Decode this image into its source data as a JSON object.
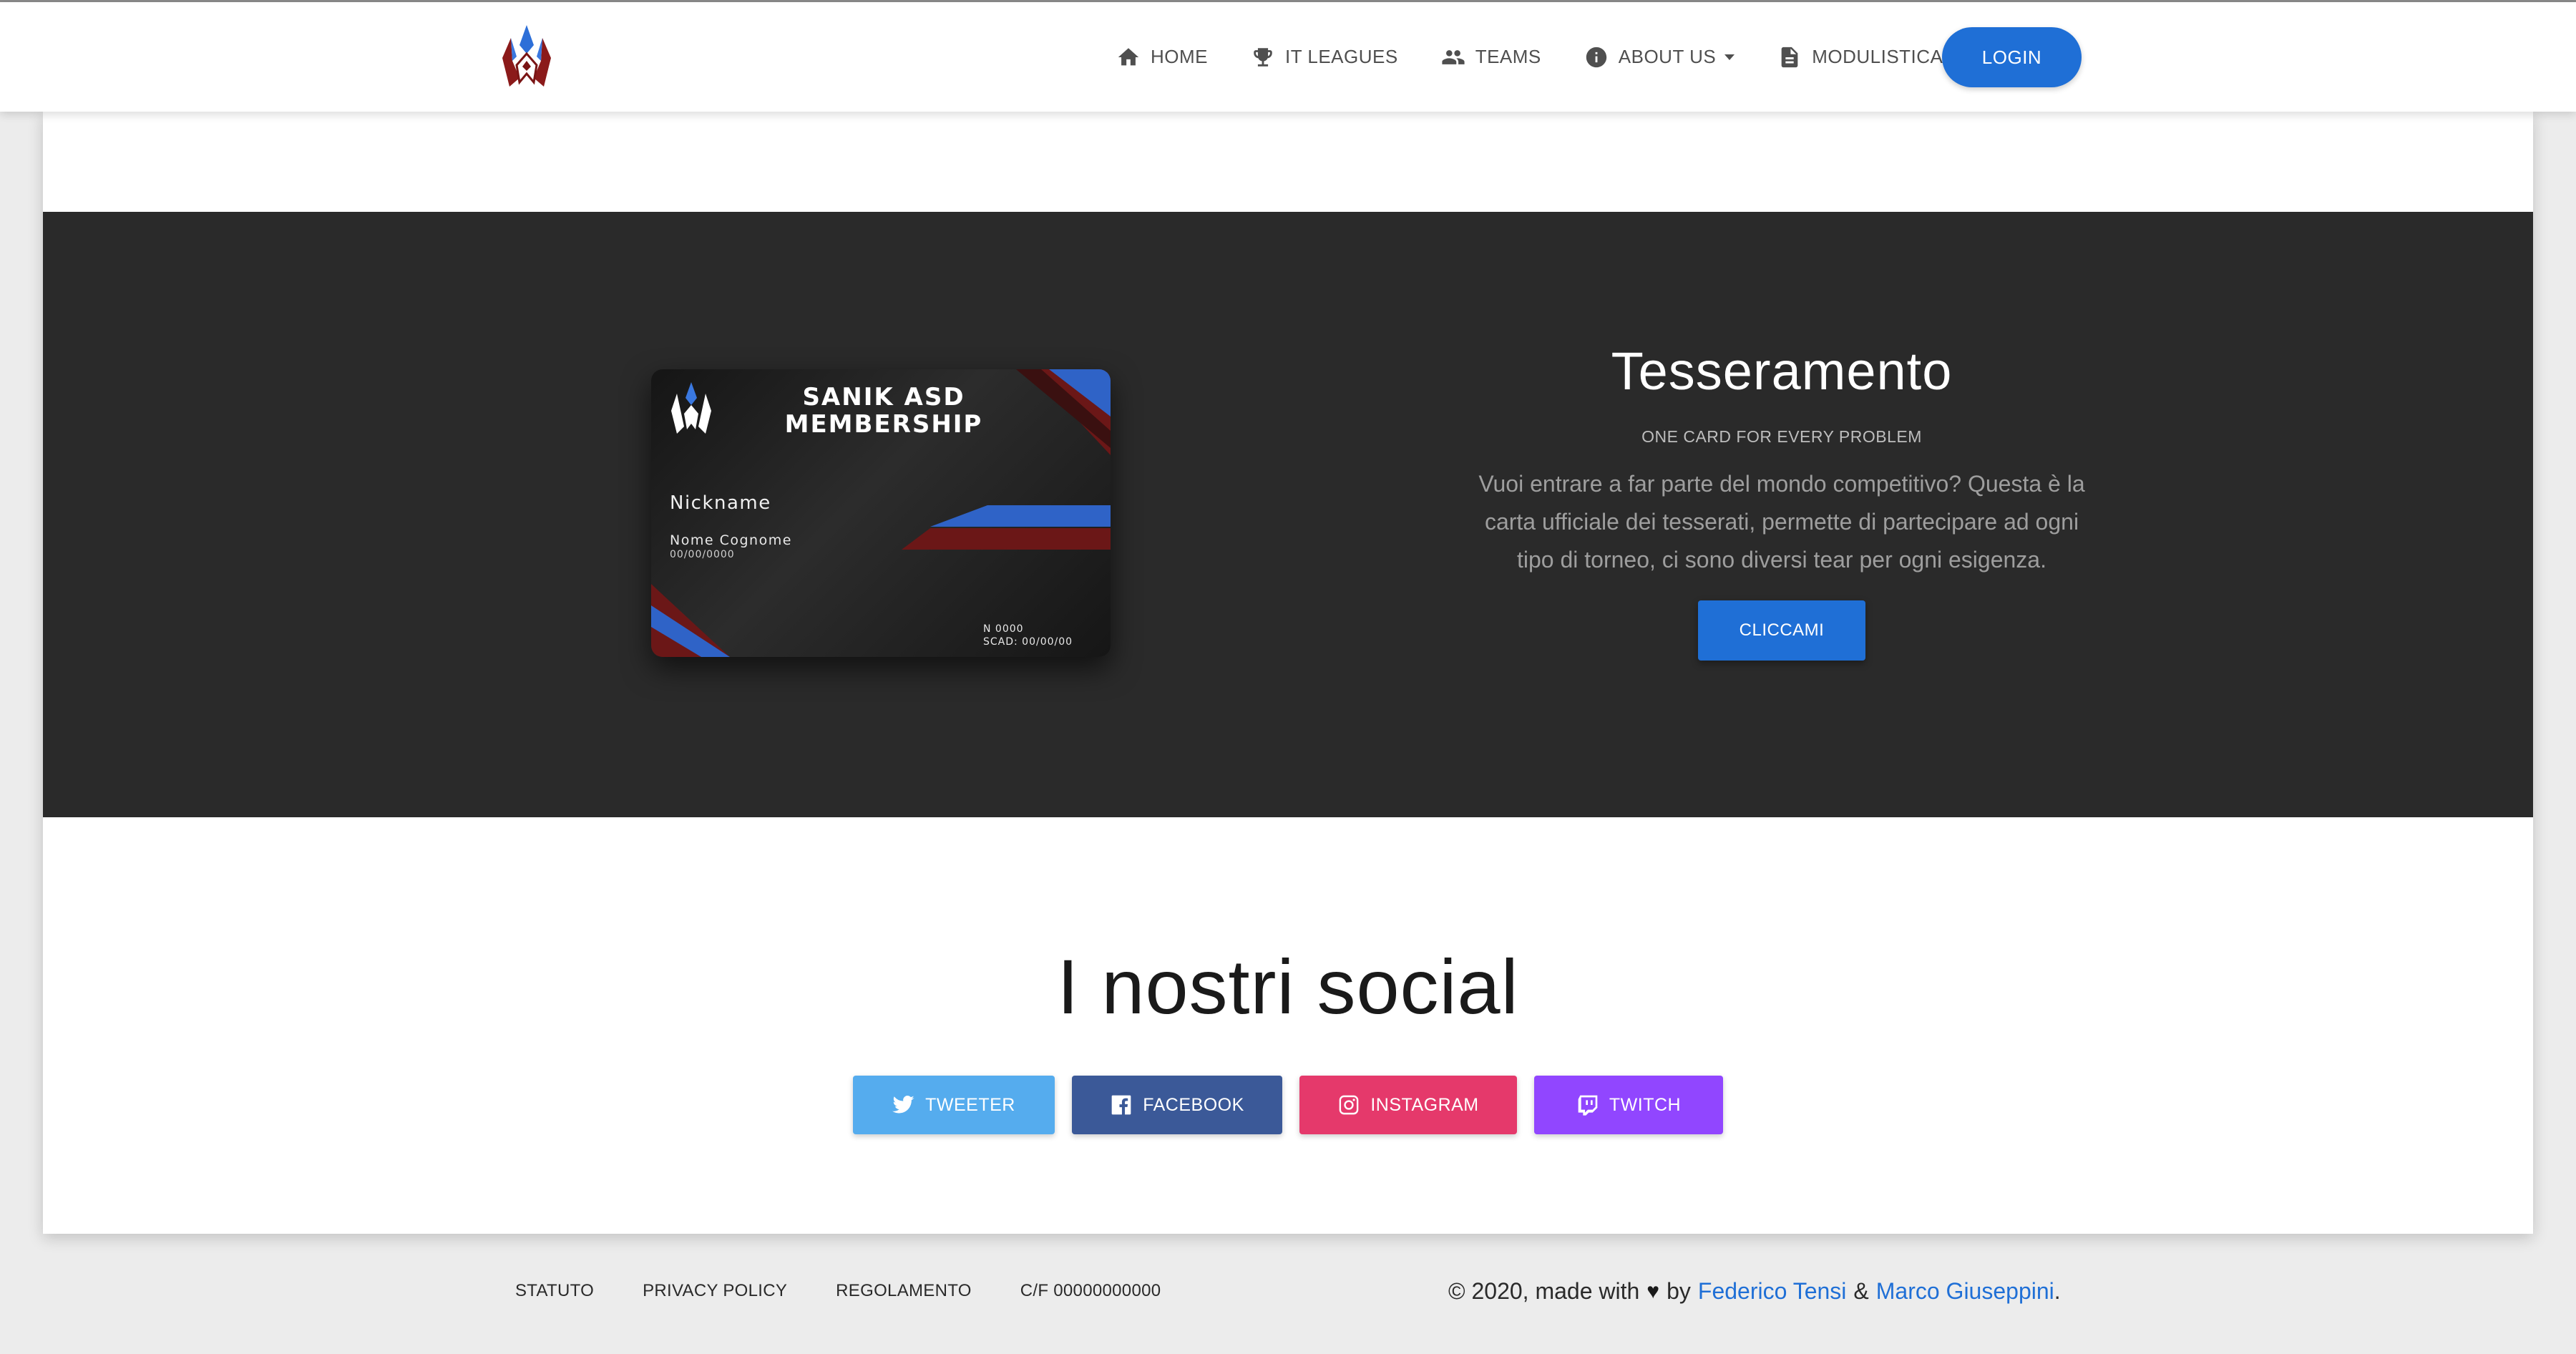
{
  "nav": {
    "items": [
      {
        "label": "HOME",
        "icon": "home-icon"
      },
      {
        "label": "IT LEAGUES",
        "icon": "trophy-icon"
      },
      {
        "label": "TEAMS",
        "icon": "people-icon"
      },
      {
        "label": "ABOUT US",
        "icon": "info-icon",
        "dropdown": true
      },
      {
        "label": "MODULISTICA",
        "icon": "document-icon",
        "dropdown": true
      }
    ],
    "login_label": "LOGIN"
  },
  "membership_card": {
    "title_line1": "SANIK ASD",
    "title_line2": "MEMBERSHIP",
    "nickname": "Nickname",
    "name": "Nome Cognome",
    "date": "00/00/0000",
    "number": "N 0000",
    "expiry": "SCAD: 00/00/00"
  },
  "tesseramento": {
    "title": "Tesseramento",
    "subtitle": "ONE CARD FOR EVERY PROBLEM",
    "text": "Vuoi entrare a far parte del mondo competitivo? Questa è la carta ufficiale dei tesserati, permette di partecipare ad ogni tipo di torneo, ci sono diversi tear per ogni esigenza.",
    "button_label": "CLICCAMI"
  },
  "social": {
    "title": "I nostri social",
    "buttons": [
      {
        "label": "TWEETER",
        "icon": "twitter-icon",
        "color": "#55acee"
      },
      {
        "label": "FACEBOOK",
        "icon": "facebook-icon",
        "color": "#3b5998"
      },
      {
        "label": "INSTAGRAM",
        "icon": "instagram-icon",
        "color": "#e5396b"
      },
      {
        "label": "TWITCH",
        "icon": "twitch-icon",
        "color": "#9146ff"
      }
    ]
  },
  "footer": {
    "links": [
      "STATUTO",
      "PRIVACY POLICY",
      "REGOLAMENTO",
      "C/F 00000000000"
    ],
    "credit_prefix": "© 2020, made with",
    "credit_by": "by",
    "author1": "Federico Tensi",
    "and": "&",
    "author2": "Marco Giuseppini",
    "period": "."
  },
  "colors": {
    "primary": "#1f6fd6",
    "dark_section": "#2a2a2a"
  }
}
